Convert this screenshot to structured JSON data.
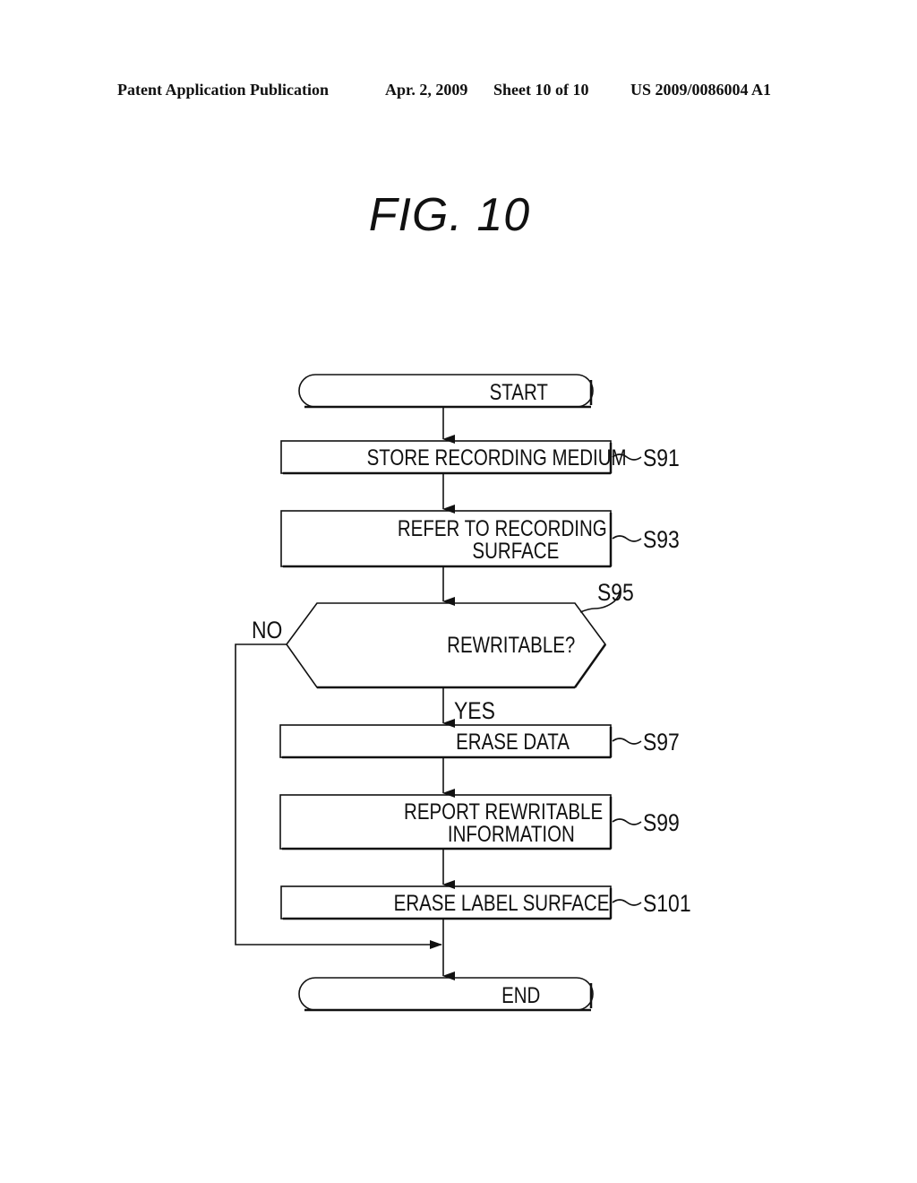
{
  "header": {
    "publication": "Patent Application Publication",
    "date": "Apr. 2, 2009",
    "sheet": "Sheet 10 of 10",
    "number": "US 2009/0086004 A1"
  },
  "figure": {
    "title": "FIG. 10"
  },
  "flowchart": {
    "start": "START",
    "end": "END",
    "steps": [
      {
        "id": "S91",
        "lines": [
          "STORE RECORDING MEDIUM"
        ]
      },
      {
        "id": "S93",
        "lines": [
          "REFER TO RECORDING",
          "SURFACE"
        ]
      },
      {
        "id": "S95",
        "lines": [
          "REWRITABLE?"
        ],
        "type": "decision"
      },
      {
        "id": "S97",
        "lines": [
          "ERASE DATA"
        ]
      },
      {
        "id": "S99",
        "lines": [
          "REPORT REWRITABLE",
          "INFORMATION"
        ]
      },
      {
        "id": "S101",
        "lines": [
          "ERASE LABEL SURFACE"
        ]
      }
    ],
    "branch_yes": "YES",
    "branch_no": "NO"
  }
}
